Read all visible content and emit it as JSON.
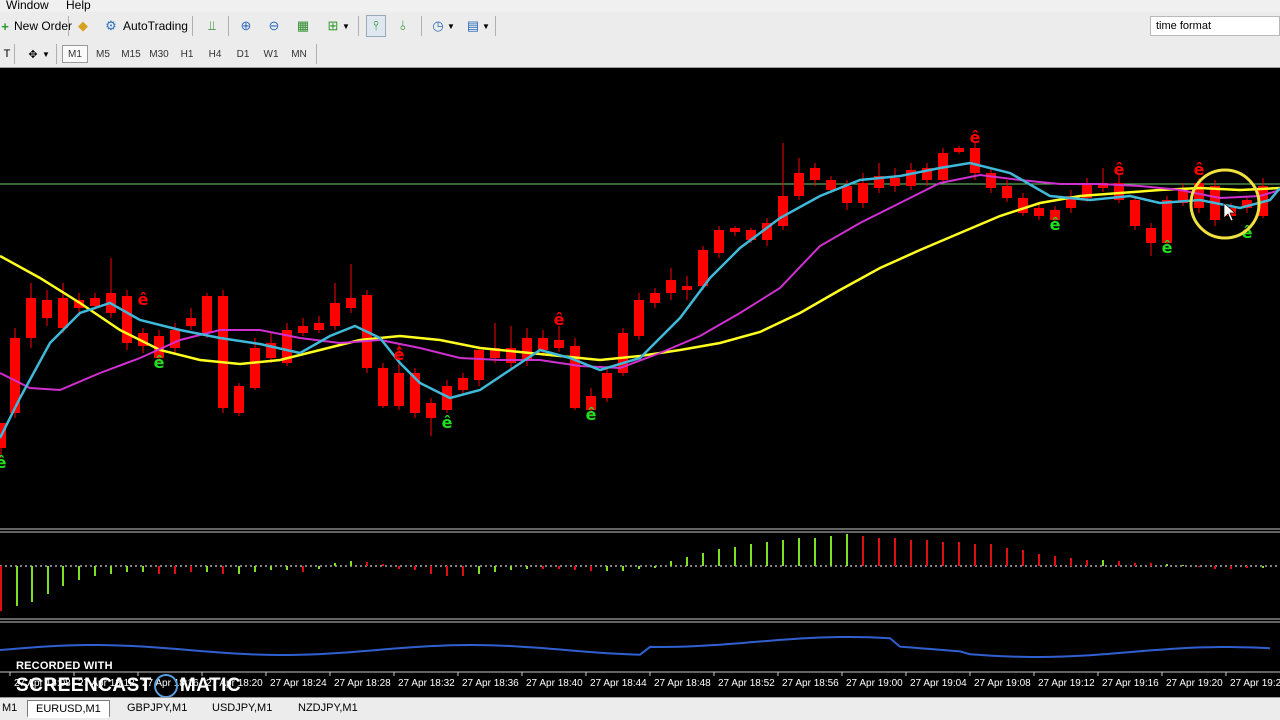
{
  "menu": {
    "window": "Window",
    "help": "Help"
  },
  "toolbar": {
    "new_order": "New Order",
    "autotrading": "AutoTrading",
    "timeframes": [
      "M1",
      "M5",
      "M15",
      "M30",
      "H1",
      "H4",
      "D1",
      "W1",
      "MN"
    ],
    "active_timeframe": "M1",
    "search_value": "time format",
    "left_letter": "T"
  },
  "chart": {
    "time_labels": [
      "27 Apr 18:08",
      "27 Apr 18:12",
      "27 Apr 18:16",
      "27 Apr 18:20",
      "27 Apr 18:24",
      "27 Apr 18:28",
      "27 Apr 18:32",
      "27 Apr 18:36",
      "27 Apr 18:40",
      "27 Apr 18:44",
      "27 Apr 18:48",
      "27 Apr 18:52",
      "27 Apr 18:56",
      "27 Apr 19:00",
      "27 Apr 19:04",
      "27 Apr 19:08",
      "27 Apr 19:12",
      "27 Apr 19:16",
      "27 Apr 19:20",
      "27 Apr 19:2"
    ],
    "signal_glyph": "ê",
    "colors": {
      "bull": "#00ff00",
      "bear": "#ff0000",
      "ma_fast": "#40b8d8",
      "ma_mid": "#d030d0",
      "ma_slow": "#ffff20",
      "level_line": "#6fd06f",
      "osc_line": "#3060d0",
      "highlight": "#f0e040"
    }
  },
  "tabs": [
    "M1",
    "EURUSD,M1",
    "GBPJPY,M1",
    "USDJPY,M1",
    "NZDJPY,M1"
  ],
  "active_tab": "EURUSD,M1",
  "watermark": {
    "line1": "RECORDED WITH",
    "line2a": "SCREENCAST",
    "line2b": "MATIC"
  }
}
